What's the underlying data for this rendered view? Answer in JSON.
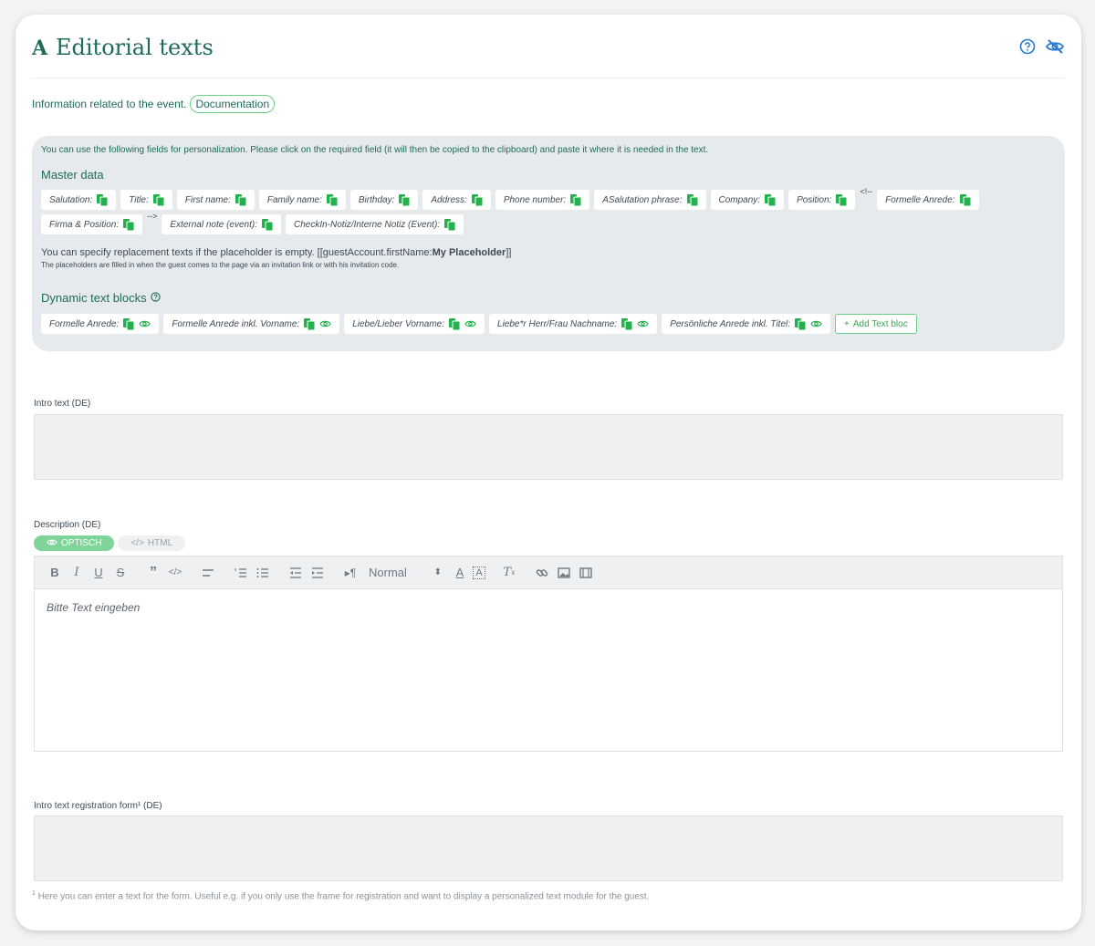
{
  "header": {
    "title": "Editorial texts",
    "title_icon": "A",
    "icons": [
      "help-circle-icon",
      "eye-off-icon"
    ]
  },
  "info": {
    "text": "Information related to the event.",
    "doc_label": "Documentation"
  },
  "personalization": {
    "hint": "You can use the following fields for personalization. Please click on the required field (it will then be copied to the clipboard) and paste it where it is needed in the text.",
    "master_title": "Master data",
    "master_chips": [
      "Salutation:",
      "Title:",
      "First name:",
      "Family name:",
      "Birthday:",
      "Address:",
      "Phone number:",
      "ASalutation phrase:",
      "Company:",
      "Position:",
      "Formelle Anrede:",
      "Firma & Position:",
      "External note (event):",
      "CheckIn-Notiz/Interne Notiz (Event):"
    ],
    "comment_open": "<!--",
    "comment_close": "-->",
    "replacement_text": "You can specify replacement texts if the placeholder is empty. [[guestAccount.firstName:",
    "replacement_bold": "My Placeholder",
    "replacement_end": "]]",
    "replacement_sub": "The placeholders are filled in when the guest comes to the page via an invitation link or with his invitation code.",
    "dynamic_title": "Dynamic text blocks",
    "dynamic_chips": [
      "Formelle Anrede:",
      "Formelle Anrede inkl. Vorname:",
      "Liebe/Lieber Vorname:",
      "Liebe*r Herr/Frau Nachname:",
      "Persönliche Anrede inkl. Titel:"
    ],
    "add_button": "Add Text bloc"
  },
  "intro": {
    "label": "Intro text (DE)",
    "value": ""
  },
  "description": {
    "label": "Description (DE)",
    "tab_visual": "OPTISCH",
    "tab_html": "HTML",
    "format_select": "Normal",
    "placeholder": "Bitte Text eingeben"
  },
  "intro_form": {
    "label": "Intro text registration form¹ (DE)",
    "value": ""
  },
  "footnote": {
    "marker": "1",
    "text": "Here you can enter a text for the form. Useful e.g. if you only use the frame for registration and want to display a personalized text module for the guest."
  },
  "colors": {
    "accent": "#1f6b5a",
    "green": "#22b14c",
    "panel": "#e6eaed"
  }
}
